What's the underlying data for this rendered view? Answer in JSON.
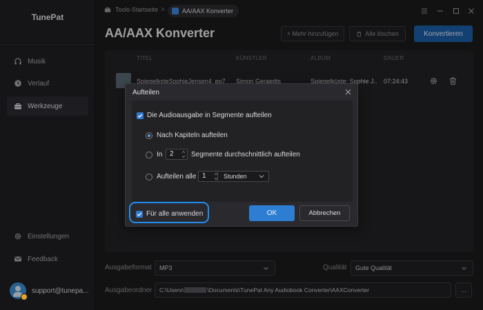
{
  "app": {
    "brand": "TunePat"
  },
  "sidebar": {
    "items": [
      {
        "label": "Musik",
        "icon": "headphones-icon"
      },
      {
        "label": "Verlauf",
        "icon": "clock-icon"
      },
      {
        "label": "Werkzeuge",
        "icon": "toolbox-icon",
        "active": true
      },
      {
        "label": "Einstellungen",
        "icon": "gear-icon"
      },
      {
        "label": "Feedback",
        "icon": "mail-icon"
      }
    ],
    "account": "support@tunepa..."
  },
  "breadcrumb": {
    "home": "Tools-Startseite",
    "separator": ">",
    "current": "AA/AAX Konverter"
  },
  "header": {
    "title": "AA/AAX Konverter",
    "add_label": "+ Mehr hinzufügen",
    "clear_label": "Alle löschen",
    "convert_label": "Konvertieren"
  },
  "table": {
    "columns": [
      "TITEL",
      "KÜNSTLER",
      "ALBUM",
      "DAUER"
    ],
    "rows": [
      {
        "title": "SpiegelksteSophieJensen4_ep7",
        "artist": "Simon Geraedts",
        "album": "Spiegelküste: Sophie J...",
        "duration": "07:24:43"
      }
    ]
  },
  "settings": {
    "format_label": "Ausgabeformat",
    "format_value": "MP3",
    "quality_label": "Qualität",
    "quality_value": "Gute Qualität",
    "folder_label": "Ausgabeordner",
    "folder_prefix": "C:\\Users\\",
    "folder_suffix": "\\Documents\\TunePat Any Audiobook Converter\\AAXConverter",
    "more_label": "..."
  },
  "dialog": {
    "title": "Aufteilen",
    "split_label": "Die Audioausgabe in Segmente aufteilen",
    "option_chapters": "Nach Kapiteln aufteilen",
    "option_segments_prefix": "In",
    "segments_value": "2",
    "option_segments_suffix": "Segmente durchschnittlich aufteilen",
    "option_every_prefix": "Aufteilen alle",
    "every_value": "1",
    "every_unit": "Stunden",
    "apply_all_label": "Für alle anwenden",
    "ok_label": "OK",
    "cancel_label": "Abbrechen"
  },
  "colors": {
    "accent": "#2d7ed2",
    "highlight": "#1f8df0",
    "background": "#1b1b1d"
  }
}
